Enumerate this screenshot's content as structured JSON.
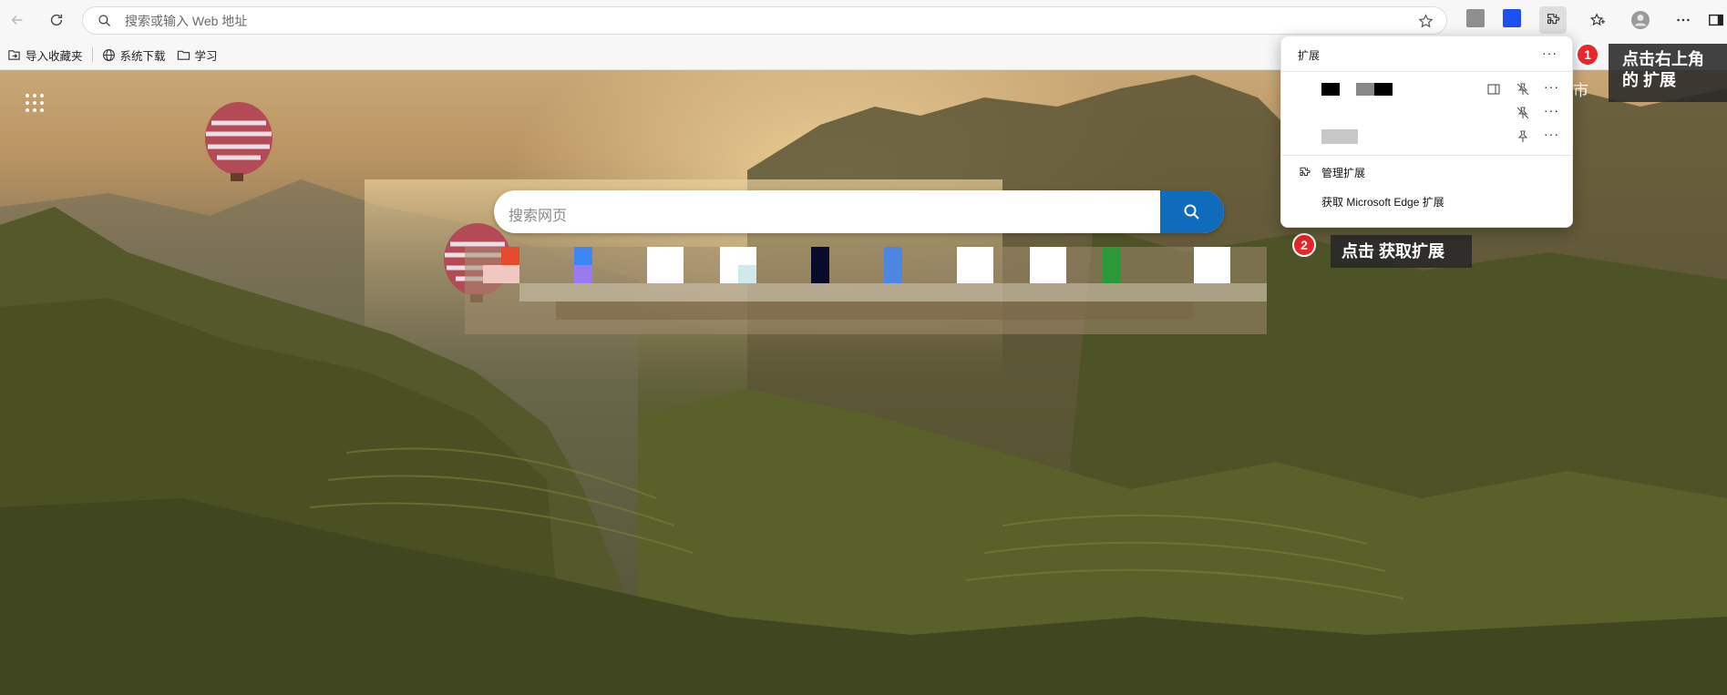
{
  "toolbar": {
    "address_placeholder": "搜索或输入 Web 地址",
    "icons": [
      "back-icon",
      "refresh-icon",
      "search-icon",
      "favorite-star-icon",
      "extensions-icon",
      "favorites-icon",
      "profile-icon",
      "more-icon",
      "sidebar-icon"
    ]
  },
  "favorites_bar": {
    "items": [
      {
        "label": "导入收藏夹",
        "icon": "import-icon"
      },
      {
        "label": "系统下载",
        "icon": "globe-icon"
      },
      {
        "label": "学习",
        "icon": "folder-icon"
      }
    ]
  },
  "new_tab": {
    "search_placeholder": "搜索网页",
    "weather_fragment": "市"
  },
  "extensions_popup": {
    "title": "扩展",
    "more": "···",
    "manage_label": "管理扩展",
    "get_label": "获取 Microsoft Edge 扩展"
  },
  "annotations": {
    "step1_number": "1",
    "step1_line1": "点击右上角",
    "step1_line2": "的 扩展",
    "step2_number": "2",
    "step2_text": "点击 获取扩展"
  },
  "colors": {
    "accent": "#0f6cbd",
    "annotation_red": "#e8262b",
    "callout_bg": "#282828"
  }
}
